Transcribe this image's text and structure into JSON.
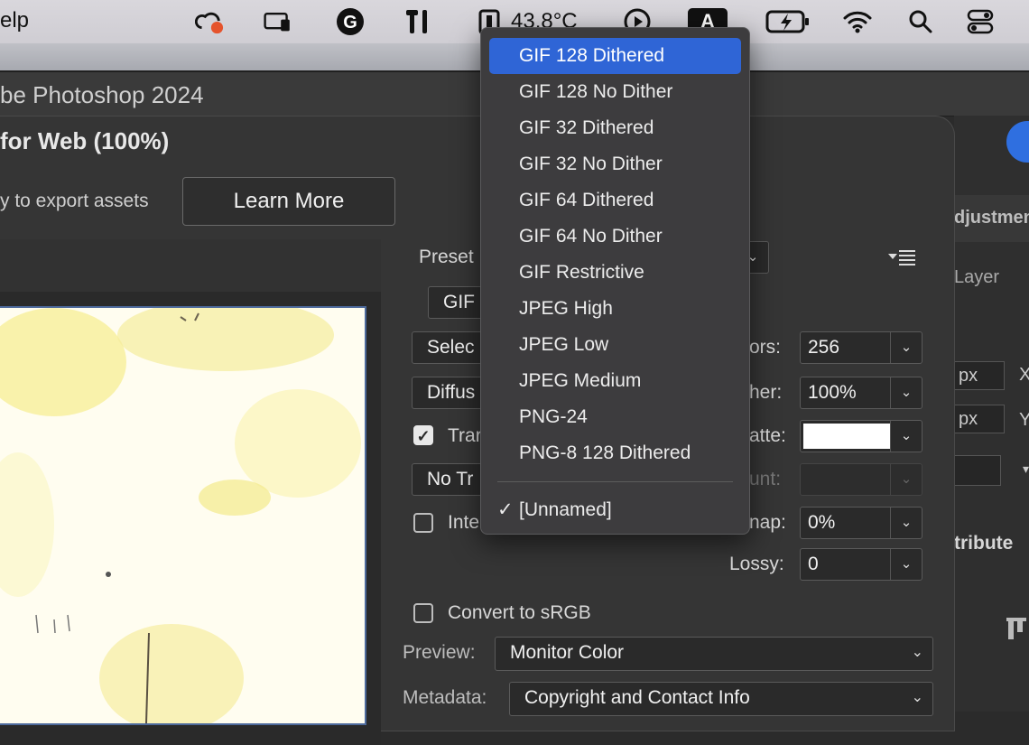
{
  "menubar": {
    "help_label": "elp",
    "temperature": "43.8°C",
    "input_source": "A",
    "icons": [
      "creative-cloud-icon",
      "cleaner-icon",
      "grammarly-icon",
      "tools-icon",
      "temperature-icon",
      "play-icon",
      "input-source-icon",
      "battery-icon",
      "wifi-icon",
      "spotlight-search-icon",
      "control-center-icon"
    ]
  },
  "app": {
    "title": "be Photoshop 2024"
  },
  "dialog": {
    "title": "for Web (100%)",
    "export_text": "y to export assets",
    "learn_more": "Learn More"
  },
  "settings": {
    "preset_label": "Preset",
    "format_value": "GIF",
    "reduction_value": "Selec",
    "dither_algo_value": "Diffus",
    "transparency_label": "Trar",
    "transparency_checked": true,
    "trans_dither_value": "No Tr",
    "interlaced_label": "Inte",
    "interlaced_checked": false,
    "colors_label": "ors:",
    "colors_value": "256",
    "dither_label": "her:",
    "dither_value": "100%",
    "matte_label": "atte:",
    "amount_label": "unt:",
    "websnap_label": "nap:",
    "websnap_value": "0%",
    "lossy_label": "Lossy:",
    "lossy_value": "0",
    "convert_srgb_label": "Convert to sRGB",
    "convert_srgb_checked": false,
    "preview_label": "Preview:",
    "preview_value": "Monitor Color",
    "metadata_label": "Metadata:",
    "metadata_value": "Copyright and Contact Info"
  },
  "right_panel": {
    "adjustments_label": "djustmen",
    "layer_label": "Layer",
    "px1": "px",
    "px2": "px",
    "x_label": "X",
    "y_label": "Y",
    "attribute_label": "tribute"
  },
  "preset_menu": {
    "items": [
      {
        "label": "GIF 128 Dithered",
        "selected": true
      },
      {
        "label": "GIF 128 No Dither"
      },
      {
        "label": "GIF 32 Dithered"
      },
      {
        "label": "GIF 32 No Dither"
      },
      {
        "label": "GIF 64 Dithered"
      },
      {
        "label": "GIF 64 No Dither"
      },
      {
        "label": "GIF Restrictive"
      },
      {
        "label": "JPEG High"
      },
      {
        "label": "JPEG Low"
      },
      {
        "label": "JPEG Medium"
      },
      {
        "label": "PNG-24"
      },
      {
        "label": "PNG-8 128 Dithered"
      }
    ],
    "checked_item": "[Unnamed]",
    "check_mark": "✓"
  }
}
